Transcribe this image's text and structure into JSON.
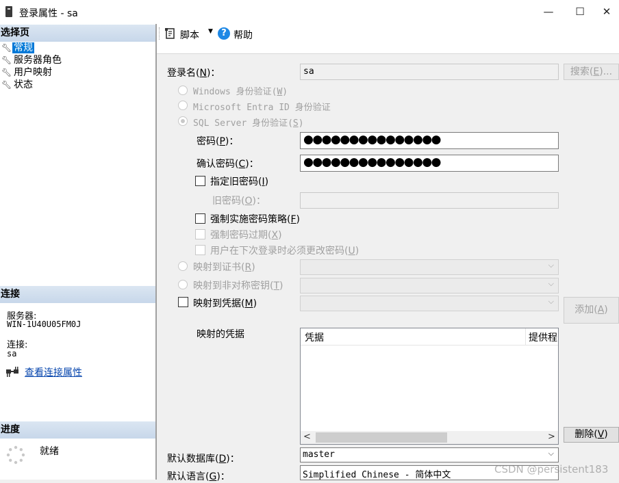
{
  "window": {
    "title": "登录属性 - sa",
    "minimize": "—",
    "maximize": "☐",
    "close": "✕"
  },
  "left": {
    "select_page_header": "选择页",
    "pages": [
      {
        "label": "常规",
        "selected": true
      },
      {
        "label": "服务器角色",
        "selected": false
      },
      {
        "label": "用户映射",
        "selected": false
      },
      {
        "label": "状态",
        "selected": false
      }
    ],
    "connection_header": "连接",
    "server_label": "服务器:",
    "server_value": "WIN-1U40U05FM0J",
    "connection_label": "连接:",
    "connection_value": "sa",
    "view_conn_props": "查看连接属性",
    "progress_header": "进度",
    "progress_status": "就绪"
  },
  "toolbar": {
    "script_label": "脚本",
    "help_label": "帮助"
  },
  "form": {
    "login_name_label": "登录名",
    "login_name_key": "N",
    "login_name_value": "sa",
    "search_button": "搜索",
    "search_key": "E",
    "auth_windows": "Windows 身份验证",
    "auth_windows_key": "W",
    "auth_entra": "Microsoft Entra ID 身份验证",
    "auth_sql": "SQL Server 身份验证",
    "auth_sql_key": "S",
    "password_label": "密码",
    "password_key": "P",
    "password_dots": "●●●●●●●●●●●●●●●",
    "confirm_label": "确认密码",
    "confirm_key": "C",
    "confirm_dots": "●●●●●●●●●●●●●●●",
    "specify_old_label": "指定旧密码",
    "specify_old_key": "I",
    "old_password_label": "旧密码",
    "old_password_key": "O",
    "enforce_policy_label": "强制实施密码策略",
    "enforce_policy_key": "F",
    "enforce_expiry_label": "强制密码过期",
    "enforce_expiry_key": "X",
    "must_change_label": "用户在下次登录时必须更改密码",
    "must_change_key": "U",
    "map_cert_label": "映射到证书",
    "map_cert_key": "R",
    "map_asym_label": "映射到非对称密钥",
    "map_asym_key": "T",
    "map_cred_label": "映射到凭据",
    "map_cred_key": "M",
    "add_button": "添加",
    "add_key": "A",
    "mapped_creds_label": "映射的凭据",
    "grid_columns": [
      "凭据",
      "提供程"
    ],
    "remove_button": "删除",
    "remove_key": "V",
    "default_db_label": "默认数据库",
    "default_db_key": "D",
    "default_db_value": "master",
    "default_lang_label": "默认语言",
    "default_lang_key": "G",
    "default_lang_value": "Simplified Chinese - 简体中文"
  },
  "watermark": "CSDN @persistent183"
}
